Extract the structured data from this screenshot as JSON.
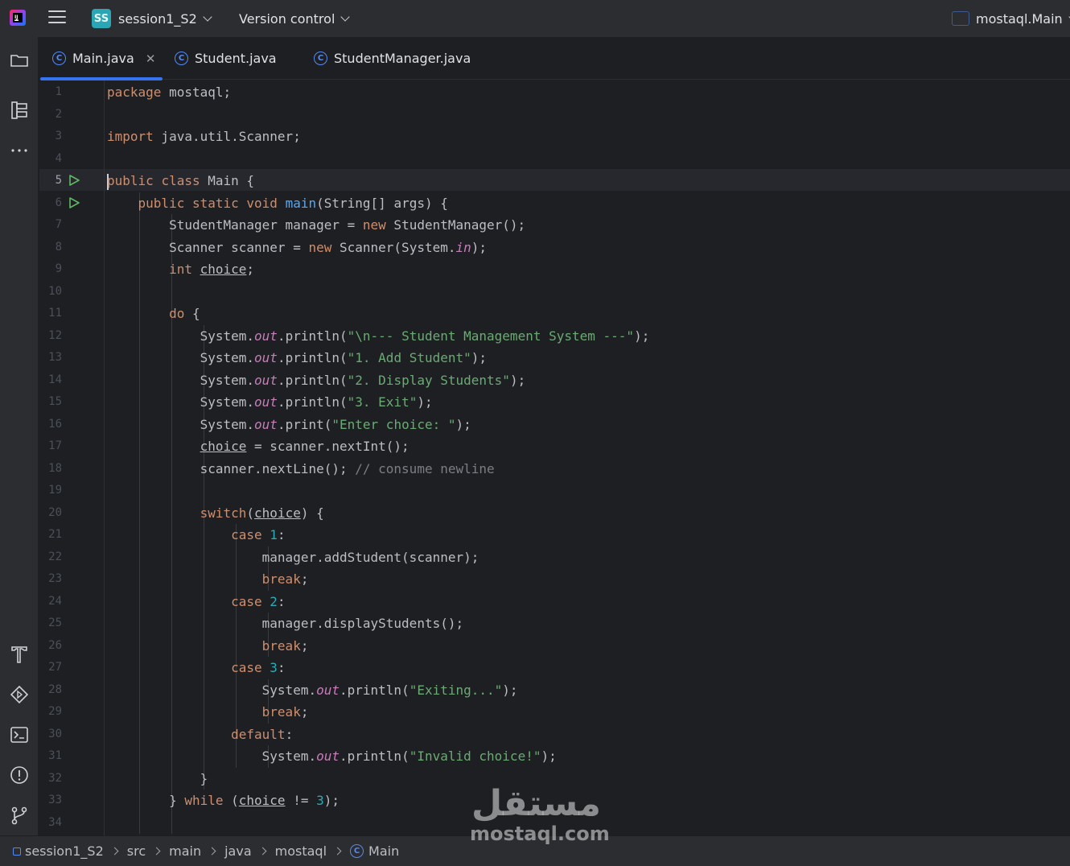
{
  "topbar": {
    "project_badge": "SS",
    "project_name": "session1_S2",
    "vcs_label": "Version control",
    "run_config": "mostaql.Main"
  },
  "tabs": [
    {
      "label": "Main.java",
      "icon": "class-icon",
      "active": true
    },
    {
      "label": "Student.java",
      "icon": "class-icon",
      "active": false
    },
    {
      "label": "StudentManager.java",
      "icon": "class-icon",
      "active": false
    }
  ],
  "editor": {
    "active_line": 5,
    "lines": [
      "package mostaql;",
      "",
      "import java.util.Scanner;",
      "",
      "public class Main {",
      "    public static void main(String[] args) {",
      "        StudentManager manager = new StudentManager();",
      "        Scanner scanner = new Scanner(System.in);",
      "        int choice;",
      "",
      "        do {",
      "            System.out.println(\"\\n--- Student Management System ---\");",
      "            System.out.println(\"1. Add Student\");",
      "            System.out.println(\"2. Display Students\");",
      "            System.out.println(\"3. Exit\");",
      "            System.out.print(\"Enter choice: \");",
      "            choice = scanner.nextInt();",
      "            scanner.nextLine(); // consume newline",
      "",
      "            switch(choice) {",
      "                case 1:",
      "                    manager.addStudent(scanner);",
      "                    break;",
      "                case 2:",
      "                    manager.displayStudents();",
      "                    break;",
      "                case 3:",
      "                    System.out.println(\"Exiting...\");",
      "                    break;",
      "                default:",
      "                    System.out.println(\"Invalid choice!\");",
      "            }",
      "        } while (choice != 3);",
      ""
    ]
  },
  "breadcrumbs": [
    "session1_S2",
    "src",
    "main",
    "java",
    "mostaql",
    "Main"
  ],
  "watermark": {
    "arabic": "مستقل",
    "latin": "mostaql.com"
  },
  "colors": {
    "accent": "#3574f0",
    "keyword": "#cf8e6d",
    "string": "#6aab73",
    "number": "#2aacb8",
    "field": "#c77dbb",
    "function": "#56a8f5",
    "comment": "#7a7e85"
  }
}
